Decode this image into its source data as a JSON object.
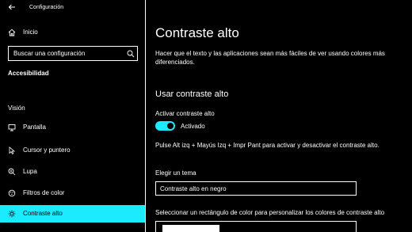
{
  "window": {
    "title": "Configuración"
  },
  "sidebar": {
    "home_label": "Inicio",
    "search": {
      "placeholder": "Buscar una configuración",
      "value": ""
    },
    "section_heading": "Accesibilidad",
    "group_heading": "Visión",
    "items": [
      {
        "label": "Pantalla",
        "icon": "monitor-icon"
      },
      {
        "label": "Cursor y puntero",
        "icon": "cursor-icon"
      },
      {
        "label": "Lupa",
        "icon": "magnifier-icon"
      },
      {
        "label": "Filtros de color",
        "icon": "color-filter-icon"
      },
      {
        "label": "Contraste alto",
        "icon": "contrast-icon",
        "selected": true
      }
    ]
  },
  "main": {
    "title": "Contraste alto",
    "description": "Hacer que el texto y las aplicaciones sean más fáciles de ver usando colores más diferenciados.",
    "section_title": "Usar contraste alto",
    "toggle": {
      "label": "Activar contraste alto",
      "state": "Activado",
      "on": true
    },
    "shortcut_hint": "Pulse Alt izq + Mayús Izq + Impr Pant para activar y desactivar el contraste alto.",
    "theme": {
      "label": "Elegir un tema",
      "value": "Contraste alto en negro"
    },
    "color_prompt": "Seleccionar un rectángulo de color para personalizar los colores de contraste alto"
  },
  "colors": {
    "accent": "#1aebff",
    "background": "#000000",
    "text": "#ffffff"
  }
}
